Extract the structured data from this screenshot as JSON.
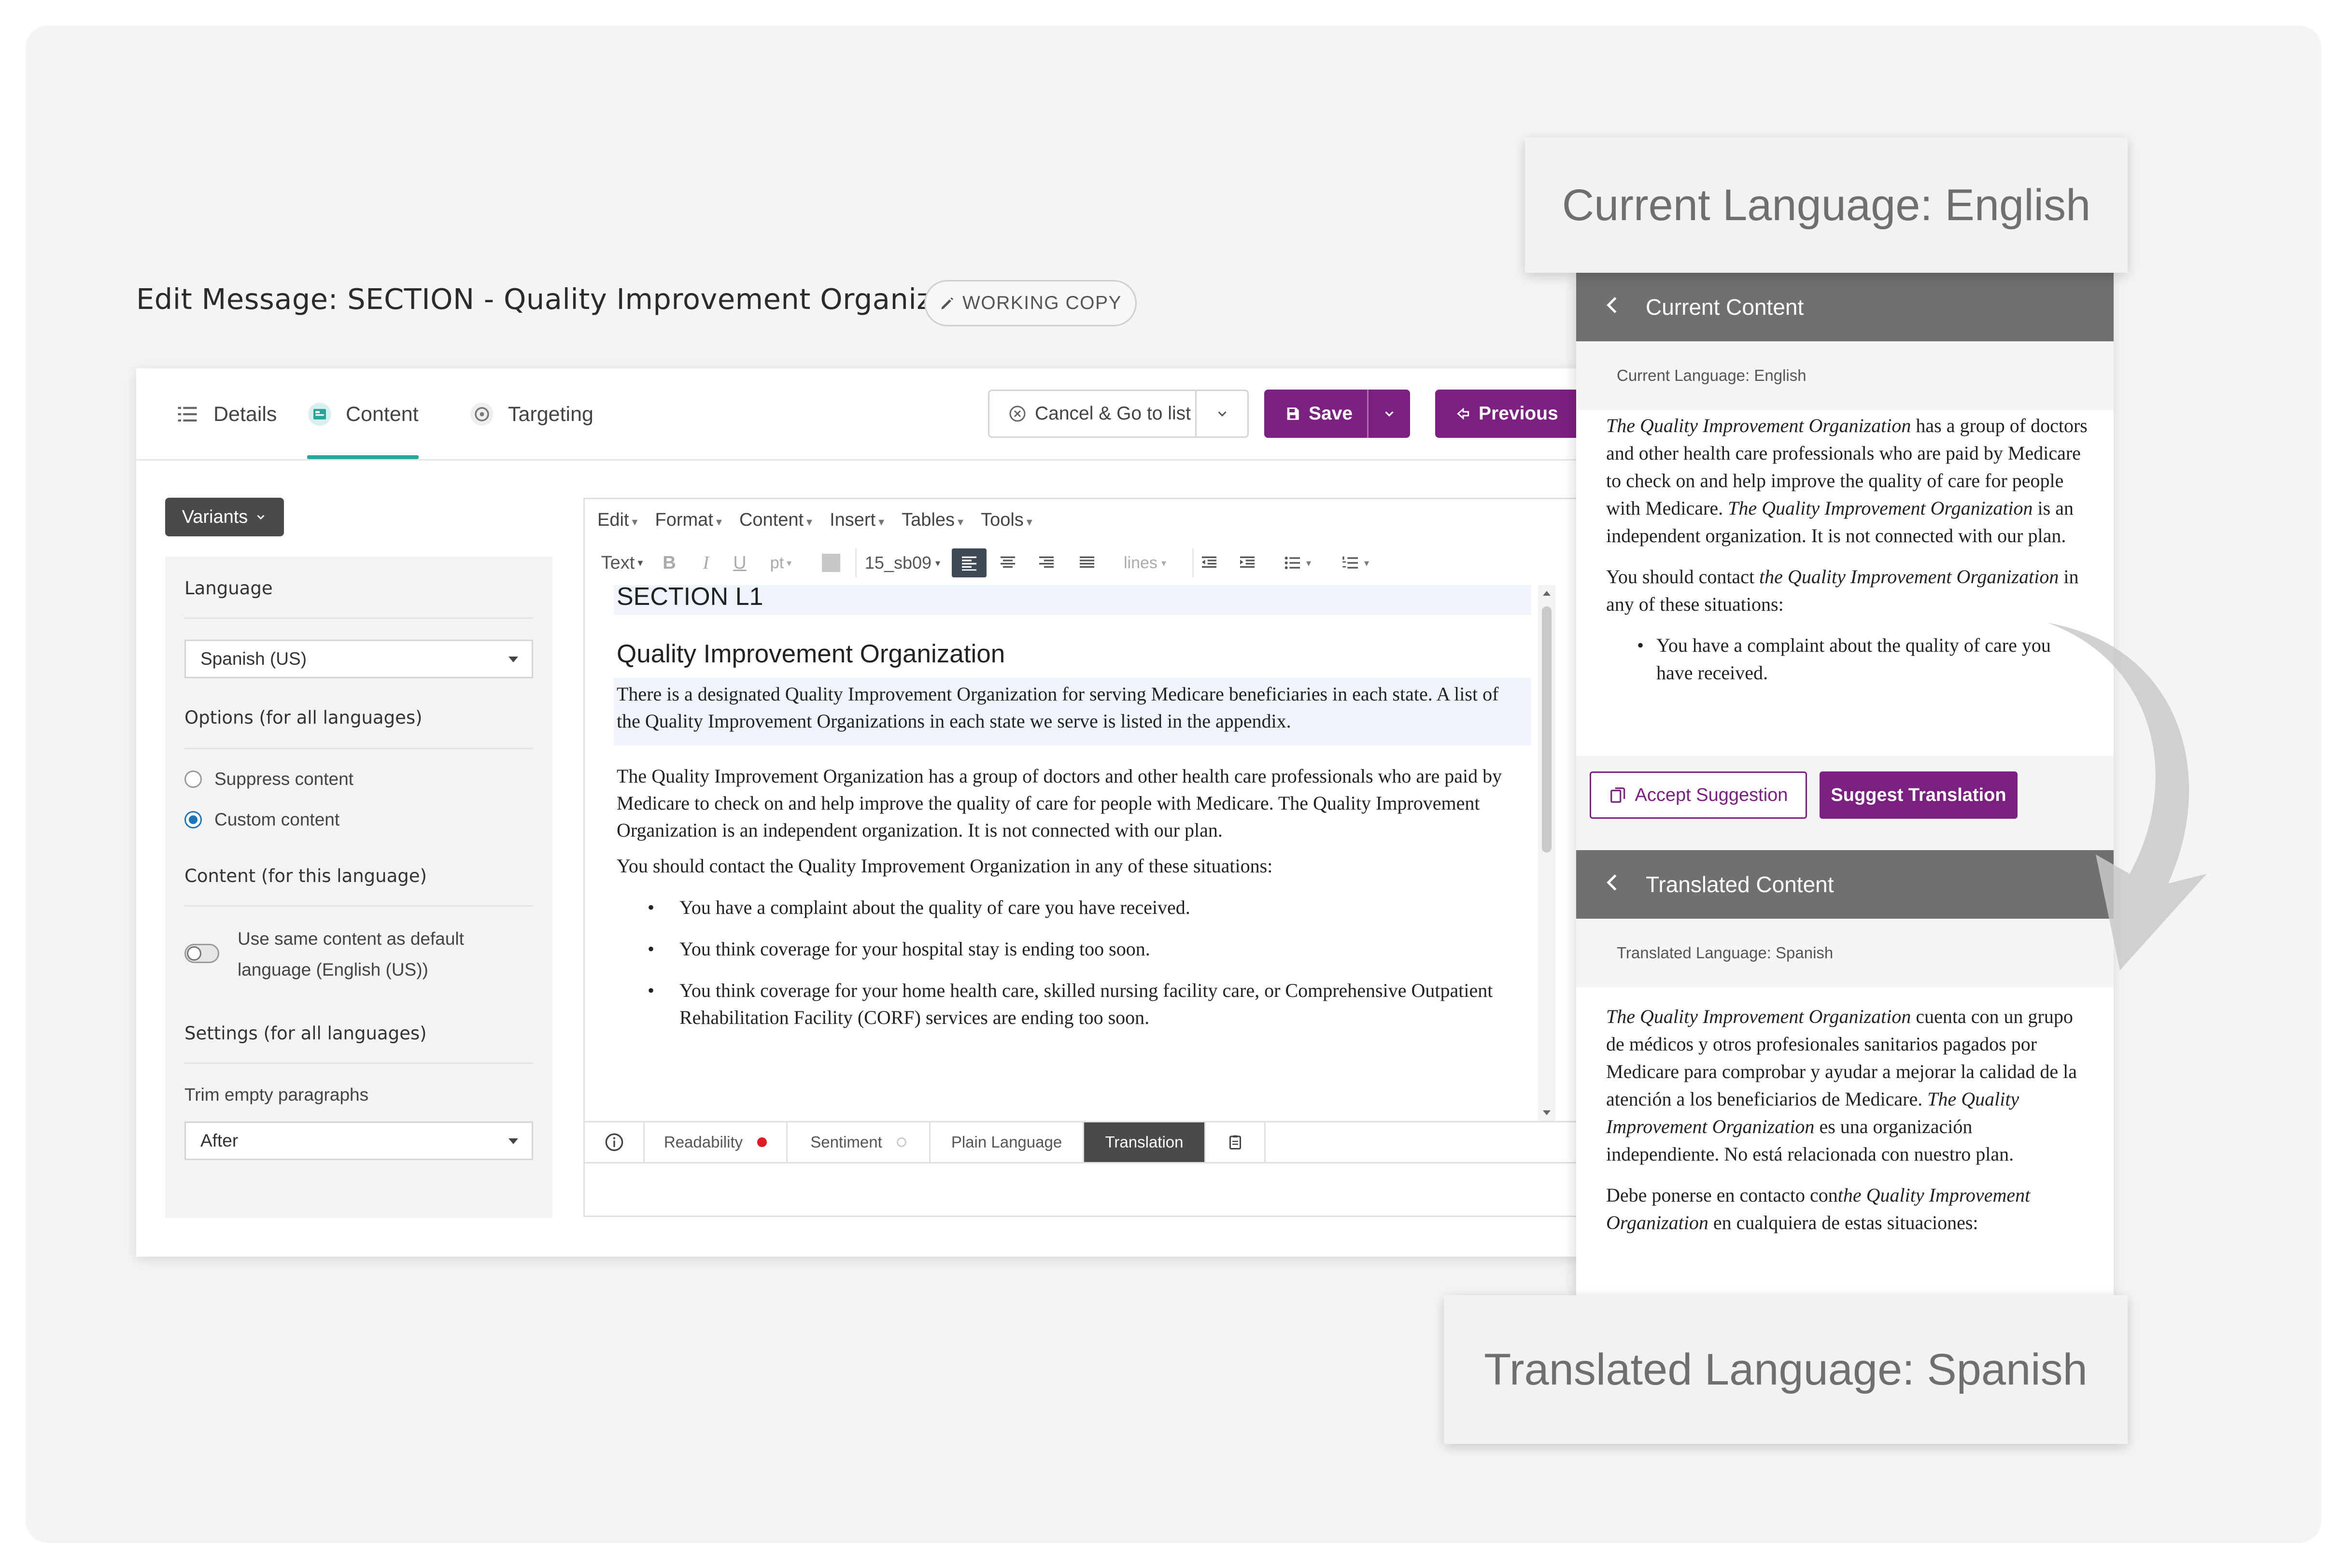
{
  "header": {
    "title": "Edit Message: SECTION - Quality Improvement Organization",
    "working_copy_badge": "WORKING COPY"
  },
  "tabs": [
    {
      "label": "Details",
      "icon": "list-icon"
    },
    {
      "label": "Content",
      "icon": "content-icon",
      "active": true
    },
    {
      "label": "Targeting",
      "icon": "targeting-icon"
    }
  ],
  "actions": {
    "cancel_label": "Cancel & Go to list",
    "save_label": "Save",
    "previous_label": "Previous"
  },
  "variants_label": "Variants",
  "settings": {
    "language_label": "Language",
    "language_value": "Spanish (US)",
    "options_label": "Options (for all languages)",
    "suppress_label": "Suppress content",
    "custom_label": "Custom content",
    "selected_option": "custom",
    "content_label": "Content (for this language)",
    "same_content_line1": "Use same content as default",
    "same_content_line2": "language (English (US))",
    "same_content_toggle": false,
    "settings_label": "Settings (for all languages)",
    "trim_label": "Trim empty paragraphs",
    "trim_value": "After"
  },
  "editor": {
    "menus": [
      "Edit",
      "Format",
      "Content",
      "Insert",
      "Tables",
      "Tools"
    ],
    "toolbar": {
      "text_style": "Text",
      "bold": "B",
      "italic": "I",
      "underline": "U",
      "pt": "pt",
      "style_name": "15_sb09",
      "lines": "lines"
    },
    "doc": {
      "section_heading": "SECTION L1",
      "heading": "Quality Improvement Organization",
      "para1": "There is a designated Quality Improvement Organization for serving Medicare beneficiaries in each state. A list of the Quality Improvement Organizations in each state we serve is listed in the appendix.",
      "para2": "The Quality Improvement Organization has a group of doctors and other health care professionals who are paid by Medicare to check on and help improve the quality of care for people with Medicare. The Quality Improvement Organization is an independent organization. It is not connected with our plan.",
      "para3": "You should contact the Quality Improvement Organization in any of these situations:",
      "bullets": [
        "You have a complaint about the quality of care you have received.",
        "You think coverage for your hospital stay is ending too soon.",
        "You think coverage for your home health care, skilled nursing facility care, or Comprehensive Outpatient Rehabilitation Facility (CORF) services are ending too soon."
      ]
    },
    "footer_tabs": {
      "readability": "Readability",
      "sentiment": "Sentiment",
      "plain_language": "Plain Language",
      "translation": "Translation"
    }
  },
  "current_panel": {
    "header": "Current Content",
    "sub_label": "Current Language: English",
    "para1_italic": "The Quality Improvement Organization",
    "para1_rest": " has a group of doctors and other health care professionals who are paid by Medicare to check on and help improve the quality of care for people with Medicare. ",
    "para1_italic2": "The Quality Improvement Organization",
    "para1_rest2": " is an independent organization. It is not connected with our plan.",
    "para2_start": "You should contact ",
    "para2_italic": "the Quality Improvement Organization",
    "para2_rest": " in any of these situations:",
    "bullet1": "You have a complaint about the quality of care you have received."
  },
  "suggestion_buttons": {
    "accept": "Accept Suggestion",
    "suggest": "Suggest Translation"
  },
  "translated_panel": {
    "header": "Translated Content",
    "sub_label": "Translated Language: Spanish",
    "para1_italic": "The Quality Improvement Organization",
    "para1_rest": " cuenta con un grupo de médicos y otros profesionales sanitarios pagados por Medicare para comprobar y ayudar a mejorar la calidad de la atención a los beneficiarios de Medicare. ",
    "para1_italic2": "The Quality Improvement Organization",
    "para1_rest2": " es una organización independiente. No está relacionada con nuestro plan.",
    "para2_start": "Debe ponerse en contacto con",
    "para2_italic": "the Quality Improvement Organization",
    "para2_rest": " en cualquiera de estas situaciones:"
  },
  "callouts": {
    "current": "Current Language: English",
    "translated": "Translated Language: Spanish"
  },
  "colors": {
    "accent_purple": "#7b1f80",
    "tab_active_teal": "#2aa39a",
    "panel_header_gray": "#707070",
    "radio_blue": "#1b75bb",
    "readability_dot_red": "#e01b24"
  }
}
